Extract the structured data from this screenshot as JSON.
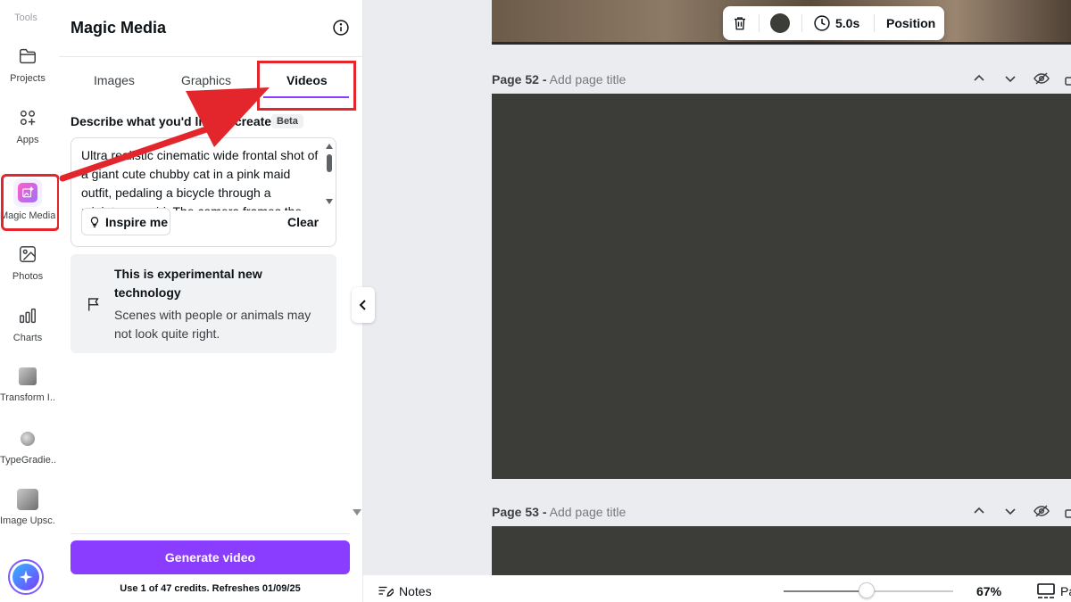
{
  "rail": {
    "top_label": "Tools",
    "items": [
      {
        "label": "Projects",
        "icon": "folder-icon"
      },
      {
        "label": "Apps",
        "icon": "apps-icon"
      },
      {
        "label": "Magic Media",
        "icon": "magic-media-icon",
        "active": true
      },
      {
        "label": "Photos",
        "icon": "photo-icon"
      },
      {
        "label": "Charts",
        "icon": "chart-icon"
      },
      {
        "label": "Transform I...",
        "icon": "transform-image-icon"
      },
      {
        "label": "TypeGradie...",
        "icon": "typegradient-icon"
      },
      {
        "label": "Image Upsc...",
        "icon": "image-upscaler-icon"
      }
    ]
  },
  "panel": {
    "title": "Magic Media",
    "tabs": [
      {
        "label": "Images"
      },
      {
        "label": "Graphics"
      },
      {
        "label": "Videos",
        "active": true
      }
    ],
    "describe_label": "Describe what you'd like to create",
    "beta_badge": "Beta",
    "prompt_text": "Ultra realistic cinematic wide frontal shot of a giant cute chubby cat in a pink maid outfit, pedaling a bicycle through a miniature world. The camera frames the",
    "inspire_label": "Inspire me",
    "clear_label": "Clear",
    "notice": {
      "title": "This is experimental new technology",
      "body": "Scenes with people or animals may not look quite right."
    },
    "generate_label": "Generate video",
    "credits_text": "Use 1 of 47 credits. Refreshes 01/09/25"
  },
  "toolbar": {
    "duration": "5.0s",
    "position_label": "Position",
    "color": "#3c3d39"
  },
  "pages": [
    {
      "number": "Page 52 -",
      "title_placeholder": "Add page title"
    },
    {
      "number": "Page 53 -",
      "title_placeholder": "Add page title"
    }
  ],
  "bottom_bar": {
    "notes_label": "Notes",
    "zoom": "67%",
    "zoom_level": 0.49,
    "pages_label": "Pages"
  },
  "colors": {
    "accent": "#8b3dff",
    "highlight": "#e3262c",
    "page_fill": "#3c3d39"
  }
}
